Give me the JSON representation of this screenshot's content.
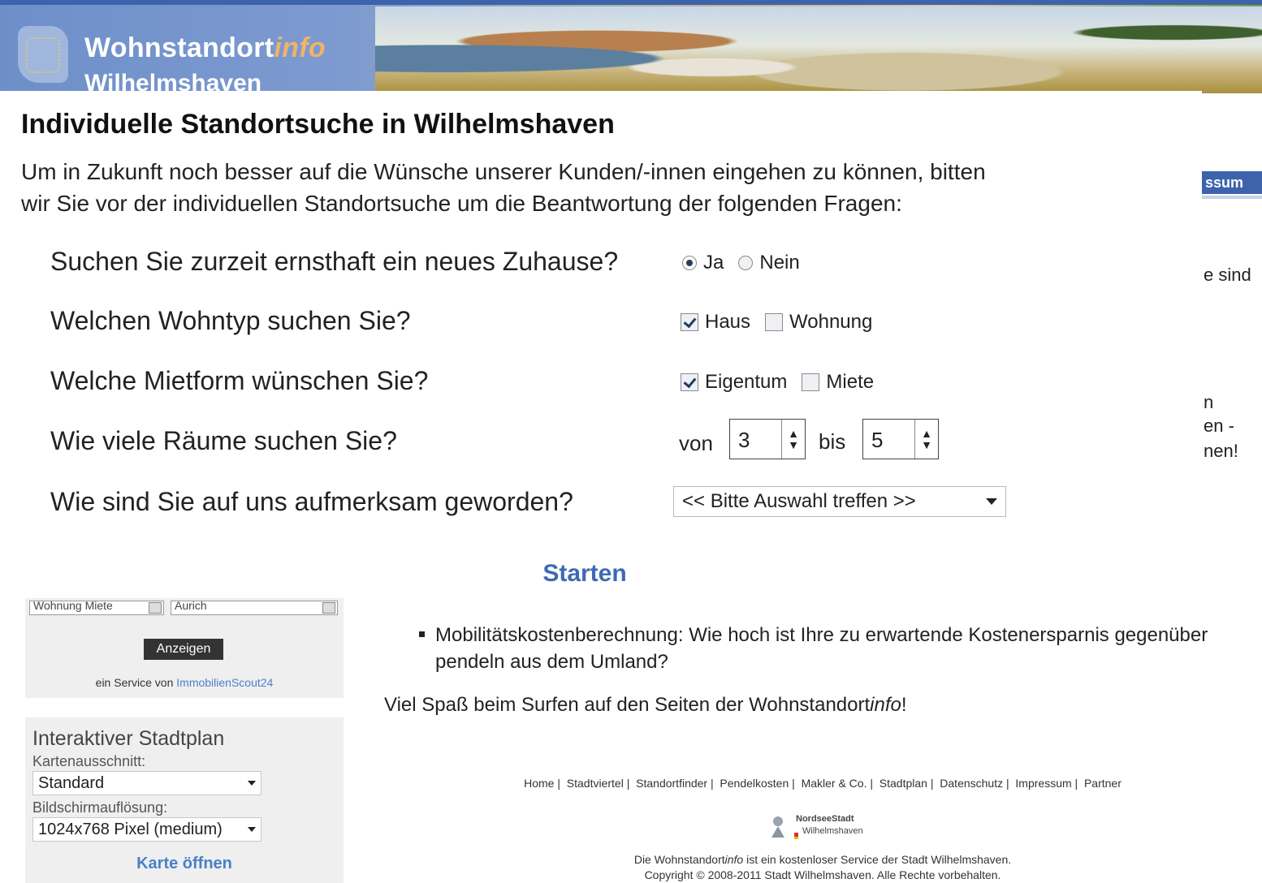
{
  "header": {
    "brand_main": "Wohnstandort",
    "brand_info": "info",
    "brand_city": "Wilhelmshaven"
  },
  "nav": {
    "right_item_fragment": "ssum"
  },
  "background_fragments": [
    "e sind",
    "n",
    "en -",
    "nen!"
  ],
  "modal": {
    "title": "Individuelle Standortsuche in Wilhelmshaven",
    "intro_line1": "Um in Zukunft noch besser auf die Wünsche unserer Kunden/-innen eingehen zu können, bitten",
    "intro_line2": "wir Sie vor der individuellen Standortsuche um die Beantwortung der folgenden Fragen:",
    "questions": {
      "q1": {
        "label": "Suchen Sie zurzeit ernsthaft ein neues Zuhause?",
        "opt_yes": "Ja",
        "opt_no": "Nein",
        "selected": "Ja"
      },
      "q2": {
        "label": "Welchen Wohntyp suchen Sie?",
        "opt1": "Haus",
        "opt1_checked": true,
        "opt2": "Wohnung",
        "opt2_checked": false
      },
      "q3": {
        "label": "Welche Mietform wünschen Sie?",
        "opt1": "Eigentum",
        "opt1_checked": true,
        "opt2": "Miete",
        "opt2_checked": false
      },
      "q4": {
        "label": "Wie viele Räume suchen Sie?",
        "from_label": "von",
        "from_value": "3",
        "to_label": "bis",
        "to_value": "5"
      },
      "q5": {
        "label": "Wie sind Sie auf uns aufmerksam geworden?",
        "selected": "<< Bitte Auswahl treffen >>"
      }
    },
    "start_label": "Starten"
  },
  "sidebar": {
    "immobilien": {
      "select1_value": "Wohnung Miete",
      "select2_value": "Aurich",
      "show_button": "Anzeigen",
      "service_prefix": "ein Service von",
      "service_link": "ImmobilienScout24"
    },
    "stadtplan": {
      "title": "Interaktiver Stadtplan",
      "map_section_label": "Kartenausschnitt:",
      "map_section_value": "Standard",
      "resolution_label": "Bildschirmauflösung:",
      "resolution_value": "1024x768 Pixel (medium)",
      "open_map": "Karte öffnen"
    }
  },
  "main": {
    "bullet_text": "Mobilitätskostenberechnung: Wie hoch ist Ihre zu erwartende Kostenersparnis gegenüber pendeln aus dem Umland?",
    "welcome_prefix": "Viel Spaß beim Surfen auf den Seiten der Wohnstandort",
    "welcome_info": "info",
    "welcome_suffix": "!"
  },
  "footer": {
    "links": [
      "Home",
      "Stadtviertel",
      "Standortfinder",
      "Pendelkosten",
      "Makler & Co.",
      "Stadtplan",
      "Datenschutz",
      "Impressum",
      "Partner"
    ],
    "logo_line1": "NordseeStadt",
    "logo_line2": "Wilhelmshaven",
    "note_line1_prefix": "Die Wohnstandort",
    "note_line1_info": "info",
    "note_line1_suffix": " ist ein kostenloser Service der Stadt Wilhelmshaven.",
    "note_line2": "Copyright © 2008-2011 Stadt Wilhelmshaven. Alle Rechte vorbehalten."
  },
  "colors": {
    "nav_blue": "#3d63ad",
    "link_blue": "#4a7fc8",
    "start_blue": "#3d6ab4",
    "sidebar_bg": "#efefef"
  }
}
